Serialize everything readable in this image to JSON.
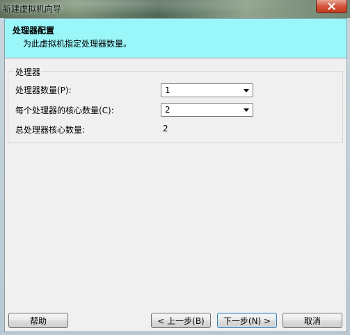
{
  "window": {
    "title": "新建虚拟机向导"
  },
  "header": {
    "title": "处理器配置",
    "subtitle": "为此虚拟机指定处理器数量。"
  },
  "processors_group": {
    "legend": "处理器",
    "processor_count": {
      "label": "处理器数量(P):",
      "value": "1"
    },
    "cores_per_processor": {
      "label": "每个处理器的核心数量(C):",
      "value": "2"
    },
    "total_cores": {
      "label": "总处理器核心数量:",
      "value": "2"
    }
  },
  "buttons": {
    "help": "帮助",
    "back": "< 上一步(B)",
    "next": "下一步(N) >",
    "cancel": "取消"
  },
  "colors": {
    "header_band": "#99f6f9",
    "close_button": "#c23a1f"
  },
  "icons": {
    "close": "close-icon",
    "dropdown": "chevron-down-icon"
  }
}
